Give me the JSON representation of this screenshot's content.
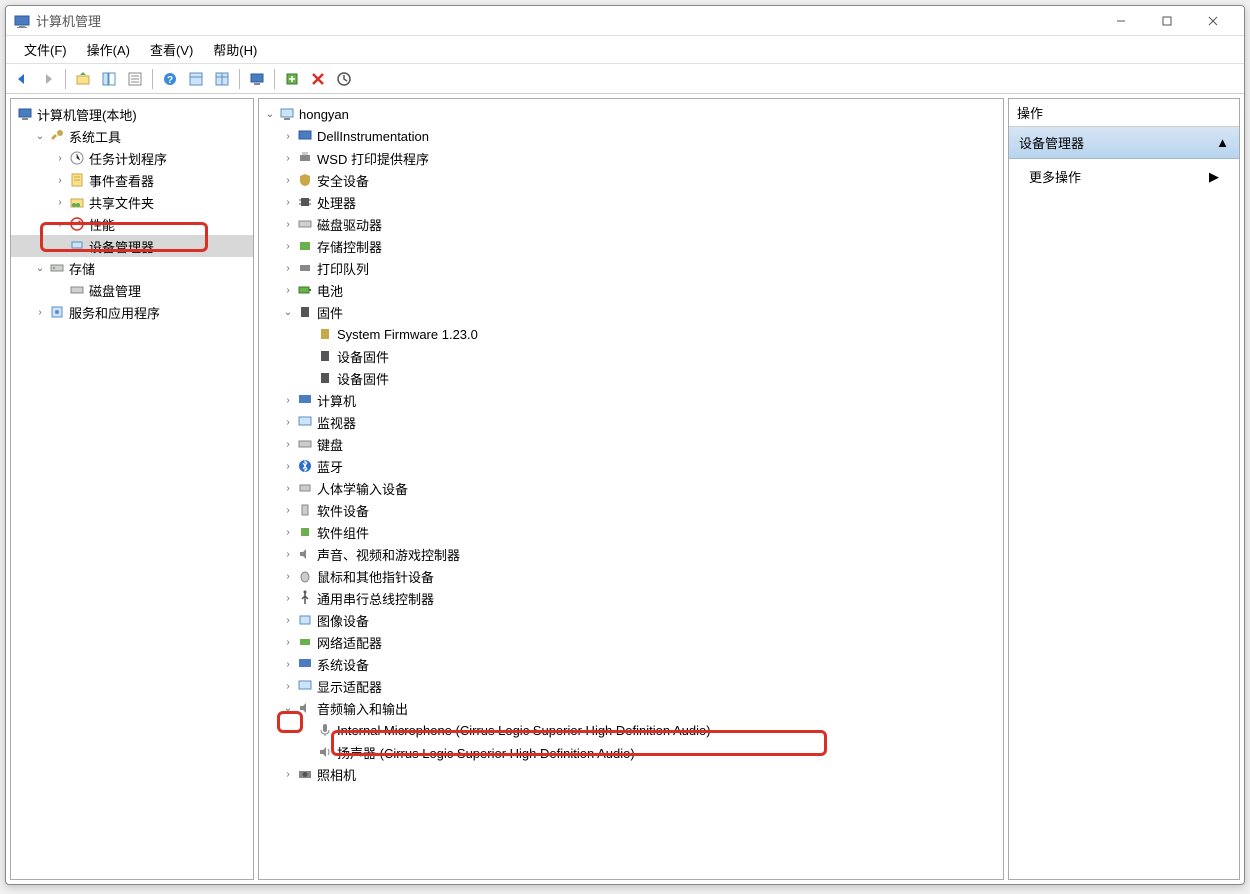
{
  "window": {
    "title": "计算机管理"
  },
  "menubar": {
    "file": "文件(F)",
    "action": "操作(A)",
    "view": "查看(V)",
    "help": "帮助(H)"
  },
  "left_tree": {
    "root": "计算机管理(本地)",
    "system_tools": "系统工具",
    "system_tools_items": {
      "task_scheduler": "任务计划程序",
      "event_viewer": "事件查看器",
      "shared_folders": "共享文件夹",
      "performance": "性能",
      "device_manager": "设备管理器"
    },
    "storage": "存储",
    "storage_items": {
      "disk_management": "磁盘管理"
    },
    "services_apps": "服务和应用程序"
  },
  "center_tree": {
    "root": "hongyan",
    "items": [
      "DellInstrumentation",
      "WSD 打印提供程序",
      "安全设备",
      "处理器",
      "磁盘驱动器",
      "存储控制器",
      "打印队列",
      "电池",
      "固件",
      "计算机",
      "监视器",
      "键盘",
      "蓝牙",
      "人体学输入设备",
      "软件设备",
      "软件组件",
      "声音、视频和游戏控制器",
      "鼠标和其他指针设备",
      "通用串行总线控制器",
      "图像设备",
      "网络适配器",
      "系统设备",
      "显示适配器",
      "音频输入和输出",
      "照相机"
    ],
    "firmware": {
      "system_firmware": "System Firmware 1.23.0",
      "device_firmware_1": "设备固件",
      "device_firmware_2": "设备固件"
    },
    "audio_io": {
      "mic": "Internal Microphone (Cirrus Logic Superior High Definition Audio)",
      "speaker": "扬声器 (Cirrus Logic Superior High Definition Audio)"
    }
  },
  "right_pane": {
    "header": "操作",
    "section": "设备管理器",
    "more_actions": "更多操作"
  }
}
